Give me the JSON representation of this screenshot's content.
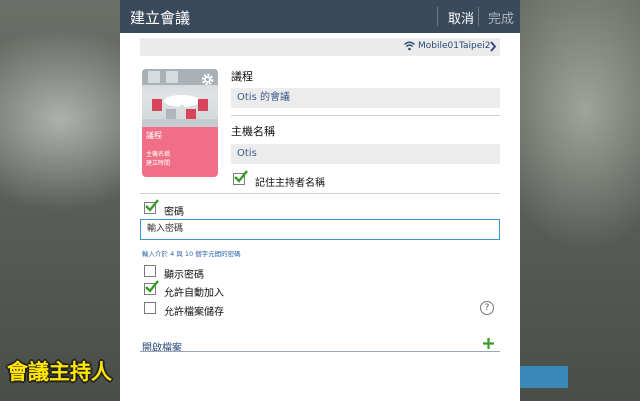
{
  "dialog": {
    "title": "建立會議",
    "cancel_label": "取消",
    "done_label": "完成"
  },
  "network": {
    "icon": "wifi-icon",
    "name": "Mobile01Taipei2"
  },
  "thumbnail": {
    "title": "議程",
    "line1": "主機名稱",
    "line2": "建立時間",
    "color": "#f06f86"
  },
  "agenda": {
    "label": "議程",
    "value": "Otis 的會議"
  },
  "host": {
    "label": "主機名稱",
    "value": "Otis",
    "remember_label": "記住主持者名稱",
    "remember_checked": true
  },
  "password": {
    "label": "密碼",
    "checked": true,
    "placeholder": "輸入密碼",
    "hint": "輸入介於 4 與 10 個字元間的密碼"
  },
  "options": [
    {
      "label": "顯示密碼",
      "checked": false
    },
    {
      "label": "允許自動加入",
      "checked": true
    },
    {
      "label": "允許檔案儲存",
      "checked": false
    }
  ],
  "open_file": {
    "label": "開啟檔案"
  },
  "watermark": "會議主持人",
  "colors": {
    "titlebar": "#3b4a5a",
    "check_green": "#3a9b2a",
    "accent_blue": "#3b97c9"
  }
}
